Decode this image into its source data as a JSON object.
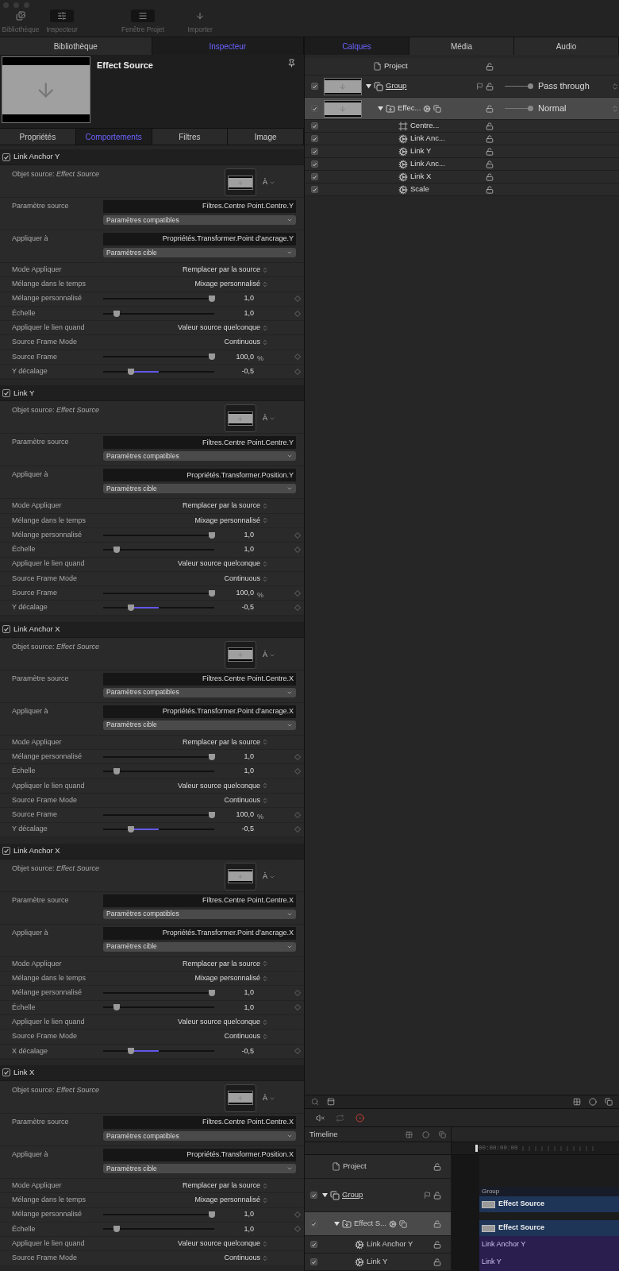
{
  "toolbar": {
    "buttons": [
      {
        "kind": "library",
        "label": "Bibliothèque",
        "selected": false
      },
      {
        "kind": "inspector",
        "label": "Inspecteur",
        "selected": true
      },
      {
        "kind": "project",
        "label": "Fenêtre Projet",
        "selected": true
      },
      {
        "kind": "import",
        "label": "Importer",
        "selected": false
      }
    ]
  },
  "left_tabs": [
    {
      "label": "Bibliothèque",
      "selected": false
    },
    {
      "label": "Inspecteur",
      "selected": true
    }
  ],
  "inspector": {
    "title": "Effect Source",
    "tabs": [
      {
        "label": "Propriétés",
        "selected": false
      },
      {
        "label": "Comportements",
        "selected": true
      },
      {
        "label": "Filtres",
        "selected": false
      },
      {
        "label": "Image",
        "selected": false
      }
    ],
    "behaviors": [
      {
        "title": "Link Anchor Y",
        "checked": true,
        "source_label": "Objet source: *Effect Source*",
        "picker": "À",
        "source_param_label": "Paramètre source",
        "source_param": "Filtres.Centre Point.Centre.Y",
        "source_menu": "Paramètres compatibles",
        "apply_label": "Appliquer à",
        "apply_param": "Propriétés.Transformer.Point d’ancrage.Y",
        "apply_menu": "Paramètres cible",
        "rows": [
          {
            "kind": "popup",
            "label": "Mode Appliquer",
            "value": "Remplacer par la source"
          },
          {
            "kind": "popup",
            "label": "Mélange dans le temps",
            "value": "Mixage personnalisé"
          },
          {
            "kind": "slider",
            "label": "Mélange personnalisé",
            "level": 0.98,
            "value": "1,0"
          },
          {
            "kind": "slider",
            "label": "Échelle",
            "level": 0.12,
            "value": "1,0"
          },
          {
            "kind": "popup",
            "label": "Appliquer le lien quand",
            "value": "Valeur source quelconque"
          },
          {
            "kind": "popup",
            "label": "Source Frame Mode",
            "value": "Continuous"
          },
          {
            "kind": "slider",
            "label": "Source Frame",
            "level": 0.98,
            "value": "100,0",
            "unit": "%"
          },
          {
            "kind": "offset",
            "label": "Y décalage",
            "level": 0.25,
            "value": "-0,5"
          }
        ]
      },
      {
        "title": "Link Y",
        "checked": true,
        "source_label": "Objet source: *Effect Source*",
        "picker": "À",
        "source_param_label": "Paramètre source",
        "source_param": "Filtres.Centre Point.Centre.Y",
        "source_menu": "Paramètres compatibles",
        "apply_label": "Appliquer à",
        "apply_param": "Propriétés.Transformer.Position.Y",
        "apply_menu": "Paramètres cible",
        "rows": [
          {
            "kind": "popup",
            "label": "Mode Appliquer",
            "value": "Remplacer par la source"
          },
          {
            "kind": "popup",
            "label": "Mélange dans le temps",
            "value": "Mixage personnalisé"
          },
          {
            "kind": "slider",
            "label": "Mélange personnalisé",
            "level": 0.98,
            "value": "1,0"
          },
          {
            "kind": "slider",
            "label": "Échelle",
            "level": 0.12,
            "value": "1,0"
          },
          {
            "kind": "popup",
            "label": "Appliquer le lien quand",
            "value": "Valeur source quelconque"
          },
          {
            "kind": "popup",
            "label": "Source Frame Mode",
            "value": "Continuous"
          },
          {
            "kind": "slider",
            "label": "Source Frame",
            "level": 0.98,
            "value": "100,0",
            "unit": "%"
          },
          {
            "kind": "offset",
            "label": "Y décalage",
            "level": 0.25,
            "value": "-0,5"
          }
        ]
      },
      {
        "title": "Link Anchor X",
        "checked": true,
        "source_label": "Objet source: *Effect Source*",
        "picker": "À",
        "source_param_label": "Paramètre source",
        "source_param": "Filtres.Centre Point.Centre.X",
        "source_menu": "Paramètres compatibles",
        "apply_label": "Appliquer à",
        "apply_param": "Propriétés.Transformer.Point d’ancrage.X",
        "apply_menu": "Paramètres cible",
        "rows": [
          {
            "kind": "popup",
            "label": "Mode Appliquer",
            "value": "Remplacer par la source"
          },
          {
            "kind": "slider",
            "label": "Mélange personnalisé",
            "level": 0.98,
            "value": "1,0"
          },
          {
            "kind": "slider",
            "label": "Échelle",
            "level": 0.12,
            "value": "1,0"
          },
          {
            "kind": "popup",
            "label": "Appliquer le lien quand",
            "value": "Valeur source quelconque"
          },
          {
            "kind": "popup",
            "label": "Source Frame Mode",
            "value": "Continuous"
          },
          {
            "kind": "slider",
            "label": "Source Frame",
            "level": 0.98,
            "value": "100,0",
            "unit": "%"
          },
          {
            "kind": "offset",
            "label": "Y décalage",
            "level": 0.25,
            "value": "-0,5"
          }
        ]
      },
      {
        "title": "Link Anchor X",
        "checked": true,
        "source_label": "Objet source: *Effect Source*",
        "picker": "À",
        "source_param_label": "Paramètre source",
        "source_param": "Filtres.Centre Point.Centre.X",
        "source_menu": "Paramètres compatibles",
        "apply_label": "Appliquer à",
        "apply_param": "Propriétés.Transformer.Point d’ancrage.X",
        "apply_menu": "Paramètres cible",
        "rows": [
          {
            "kind": "popup",
            "label": "Mode Appliquer",
            "value": "Remplacer par la source"
          },
          {
            "kind": "popup",
            "label": "Mélange dans le temps",
            "value": "Mixage personnalisé"
          },
          {
            "kind": "slider",
            "label": "Mélange personnalisé",
            "level": 0.98,
            "value": "1,0"
          },
          {
            "kind": "slider",
            "label": "Échelle",
            "level": 0.12,
            "value": "1,0"
          },
          {
            "kind": "popup",
            "label": "Appliquer le lien quand",
            "value": "Valeur source quelconque"
          },
          {
            "kind": "popup",
            "label": "Source Frame Mode",
            "value": "Continuous"
          },
          {
            "kind": "offset",
            "label": "X décalage",
            "level": 0.25,
            "value": "-0,5"
          }
        ]
      },
      {
        "title": "Link X",
        "checked": true,
        "source_label": "Objet source: *Effect Source*",
        "picker": "À",
        "source_param_label": "Paramètre source",
        "source_param": "Filtres.Centre Point.Centre.X",
        "source_menu": "Paramètres compatibles",
        "apply_label": "Appliquer à",
        "apply_param": "Propriétés.Transformer.Position.X",
        "apply_menu": "Paramètres cible",
        "rows": [
          {
            "kind": "popup",
            "label": "Mode Appliquer",
            "value": "Remplacer par la source"
          },
          {
            "kind": "popup",
            "label": "Mélange dans le temps",
            "value": "Mixage personnalisé"
          },
          {
            "kind": "slider",
            "label": "Mélange personnalisé",
            "level": 0.98,
            "value": "1,0"
          },
          {
            "kind": "slider",
            "label": "Échelle",
            "level": 0.12,
            "value": "1,0"
          },
          {
            "kind": "popup",
            "label": "Appliquer le lien quand",
            "value": "Valeur source quelconque"
          },
          {
            "kind": "popup",
            "label": "Source Frame Mode",
            "value": "Continuous"
          }
        ]
      }
    ]
  },
  "right_tabs": [
    {
      "label": "Calques",
      "selected": true
    },
    {
      "label": "Média",
      "selected": false
    },
    {
      "label": "Audio",
      "selected": false
    }
  ],
  "layers": [
    {
      "kind": "project",
      "name": "Project",
      "selected": false
    },
    {
      "kind": "group",
      "name": "Group",
      "checked": true,
      "expanded": true,
      "selected": false,
      "level": 1,
      "blend": "Pass through",
      "children": [
        {
          "kind": "effect",
          "name": "Effec...",
          "checked": true,
          "expanded": true,
          "selected": true,
          "level": 1,
          "blend": "Normal",
          "children": [
            {
              "kind": "filter",
              "name": "Centre...",
              "checked": true,
              "selected": false
            },
            {
              "kind": "behavior",
              "name": "Link Anc...",
              "checked": true,
              "selected": false
            },
            {
              "kind": "behavior",
              "name": "Link Y",
              "checked": true,
              "selected": false
            },
            {
              "kind": "behavior",
              "name": "Link Anc...",
              "checked": true,
              "selected": false
            },
            {
              "kind": "behavior",
              "name": "Link X",
              "checked": true,
              "selected": false
            },
            {
              "kind": "behavior",
              "name": "Scale",
              "checked": true,
              "selected": false
            }
          ]
        }
      ]
    }
  ],
  "timeline": {
    "title": "Timeline",
    "timecode": "00:00:00:00",
    "layers": [
      {
        "kind": "project",
        "name": "Project",
        "selected": false
      },
      {
        "kind": "group",
        "name": "Group",
        "checked": true,
        "expanded": true,
        "selected": false,
        "children": [
          {
            "kind": "effect",
            "name": "Effect S...",
            "checked": true,
            "expanded": true,
            "selected": true,
            "children": [
              {
                "kind": "behavior",
                "name": "Link Anchor Y",
                "checked": true,
                "selected": false
              },
              {
                "kind": "behavior",
                "name": "Link Y",
                "checked": true,
                "selected": false
              }
            ]
          }
        ]
      }
    ],
    "tracks": [
      {
        "kind": "empty"
      },
      {
        "kind": "group",
        "title": "Group",
        "clip": "Effect Source"
      },
      {
        "kind": "clip",
        "clip": "Effect Source"
      },
      {
        "kind": "behavior",
        "clip": "Link Anchor Y"
      },
      {
        "kind": "behavior",
        "clip": "Link Y"
      }
    ]
  }
}
